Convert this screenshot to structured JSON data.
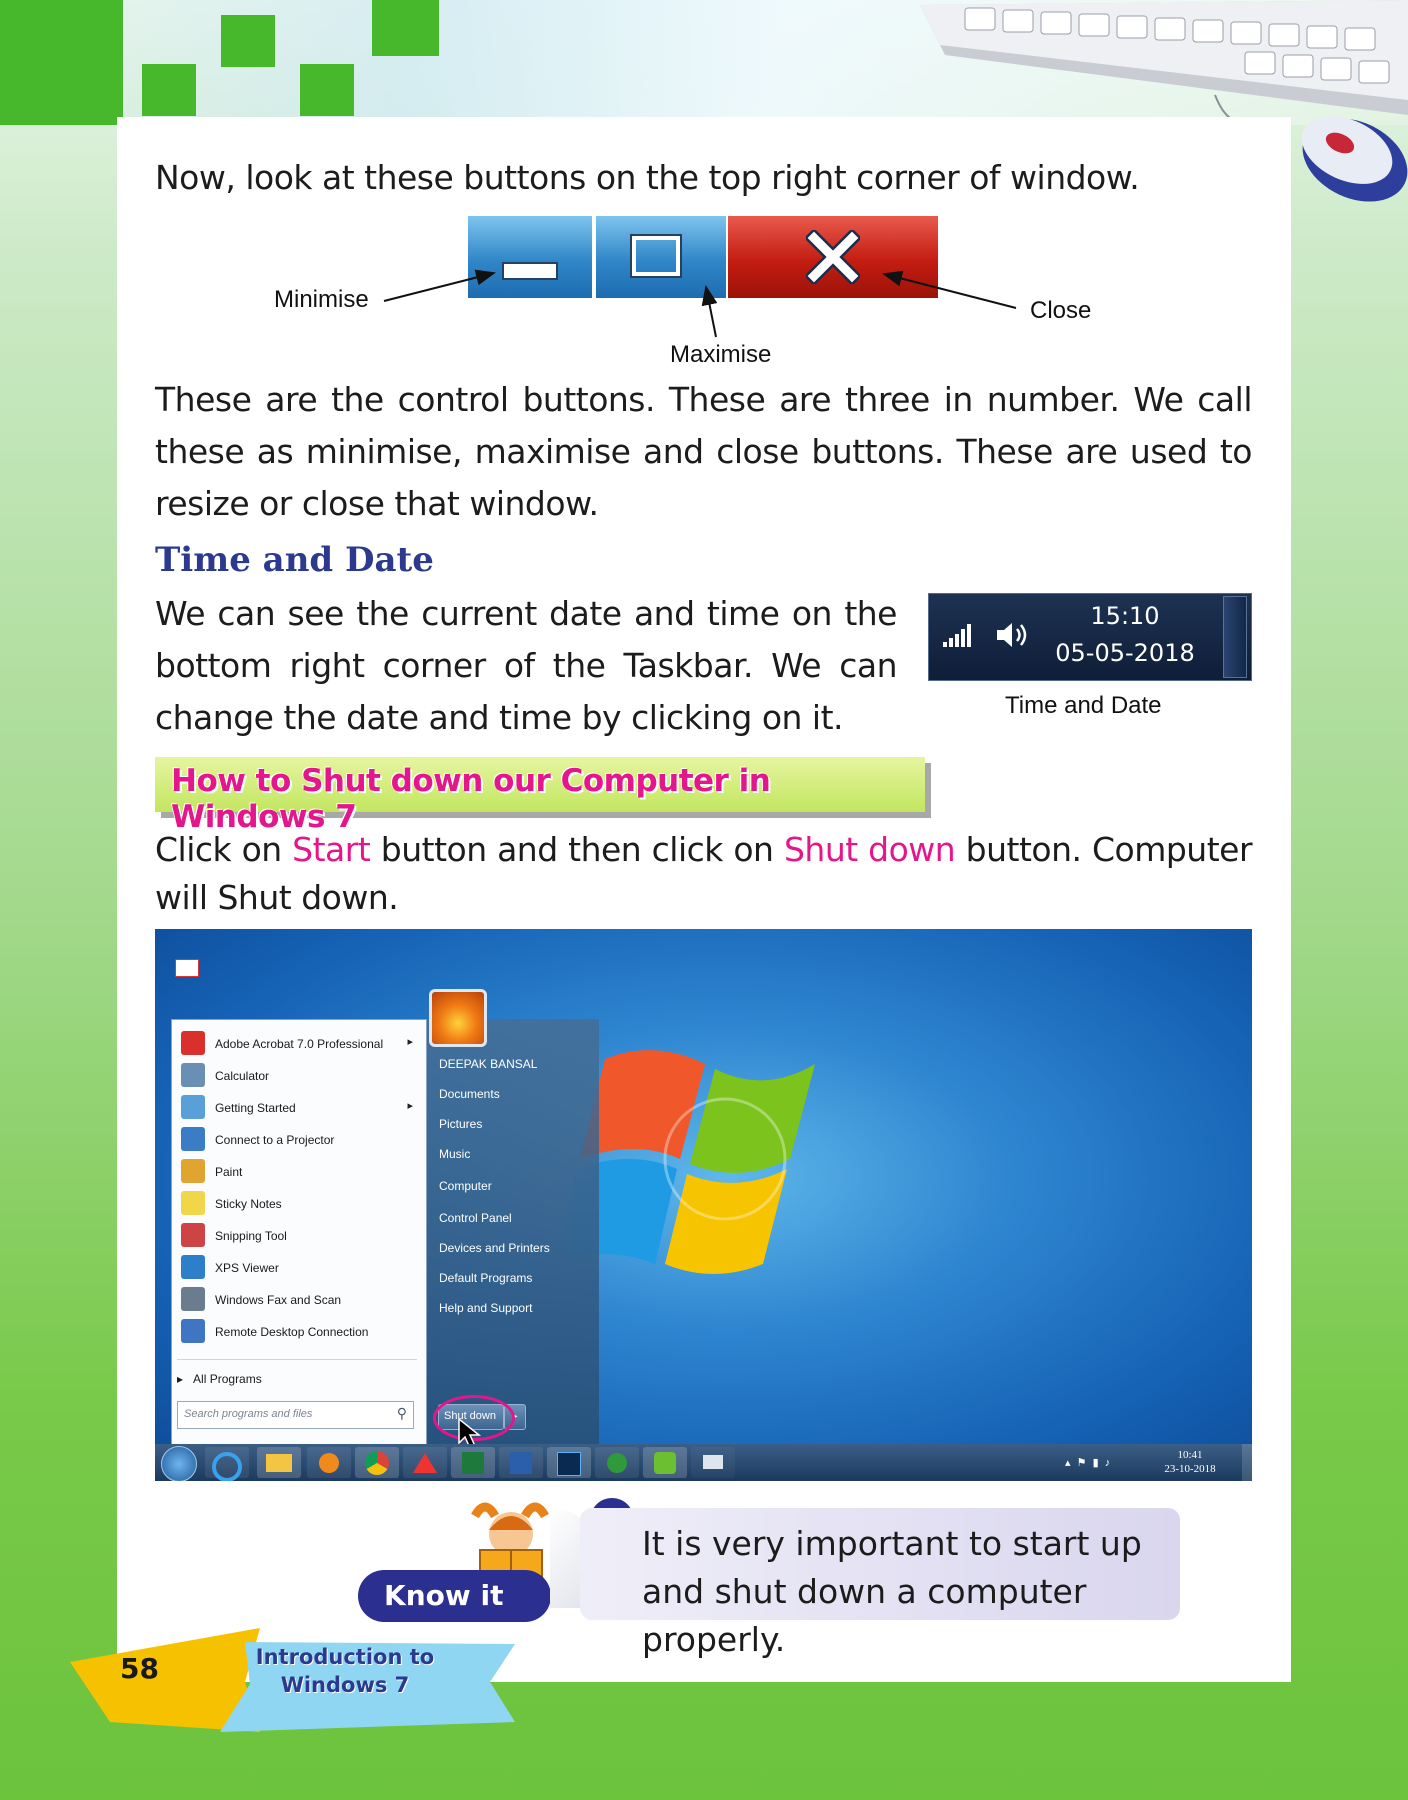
{
  "page_number": "58",
  "chapter": {
    "line1": "Introduction to",
    "line2": "Windows 7"
  },
  "intro": "Now, look at these buttons on the top right corner of window.",
  "control_labels": {
    "minimise": "Minimise",
    "maximise": "Maximise",
    "close": "Close"
  },
  "control_text": "These are the control buttons. These are three in number. We call these as minimise, maximise and close buttons. These are used to resize or close that window.",
  "time_heading": "Time and Date",
  "time_text": "We can see the current date and time on the bottom right corner of the Taskbar. We can change the date and time by clicking on it.",
  "clock": {
    "time": "15:10",
    "date": "05-05-2018",
    "caption": "Time and Date"
  },
  "banner": "How to Shut down our Computer in Windows 7",
  "shutdown_text": {
    "p1": "Click on ",
    "start": "Start",
    "p2": " button and then click on ",
    "shutdown": "Shut down",
    "p3": " button. Computer will Shut down."
  },
  "start_menu": {
    "left_items": [
      "Adobe Acrobat 7.0 Professional",
      "Calculator",
      "Getting Started",
      "Connect to a Projector",
      "Paint",
      "Sticky Notes",
      "Snipping Tool",
      "XPS Viewer",
      "Windows Fax and Scan",
      "Remote Desktop Connection"
    ],
    "all_programs": "All Programs",
    "search_placeholder": "Search programs and files",
    "right_items": [
      "DEEPAK BANSAL",
      "Documents",
      "Pictures",
      "Music",
      "Computer",
      "Control Panel",
      "Devices and Printers",
      "Default Programs",
      "Help and Support"
    ],
    "shutdown_button": "Shut down"
  },
  "taskbar_clock": {
    "time": "10:41",
    "date": "23-10-2018"
  },
  "know_it": {
    "label": "Know it",
    "text": "It is very important to start up and shut down a computer properly."
  },
  "colors": {
    "accent_pink": "#e4168c",
    "heading_blue": "#2b3a8f",
    "green": "#47b82c"
  }
}
